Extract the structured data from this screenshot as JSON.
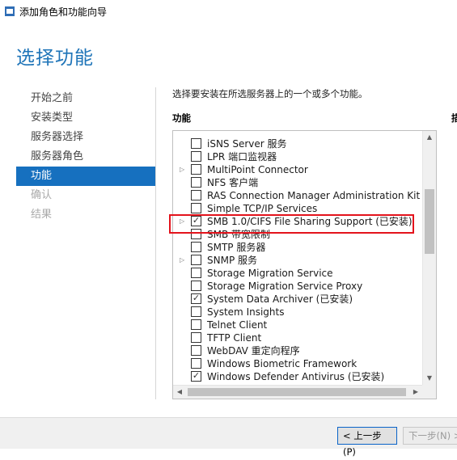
{
  "window": {
    "title": "添加角色和功能向导"
  },
  "page_heading": "选择功能",
  "nav": {
    "items": [
      {
        "label": "开始之前",
        "state": "normal"
      },
      {
        "label": "安装类型",
        "state": "normal"
      },
      {
        "label": "服务器选择",
        "state": "normal"
      },
      {
        "label": "服务器角色",
        "state": "normal"
      },
      {
        "label": "功能",
        "state": "active"
      },
      {
        "label": "确认",
        "state": "disabled"
      },
      {
        "label": "结果",
        "state": "disabled"
      }
    ]
  },
  "instruction": "选择要安装在所选服务器上的一个或多个功能。",
  "features_label": "功能",
  "description_label_partial": "描",
  "features": [
    {
      "label": "iSNS Server 服务",
      "checked": false,
      "expandable": false
    },
    {
      "label": "LPR 端口监视器",
      "checked": false,
      "expandable": false
    },
    {
      "label": "MultiPoint Connector",
      "checked": false,
      "expandable": true
    },
    {
      "label": "NFS 客户端",
      "checked": false,
      "expandable": false
    },
    {
      "label": "RAS Connection Manager Administration Kit (C",
      "checked": false,
      "expandable": false
    },
    {
      "label": "Simple TCP/IP Services",
      "checked": false,
      "expandable": false
    },
    {
      "label": "SMB 1.0/CIFS File Sharing Support (已安装)",
      "checked": true,
      "expandable": true,
      "highlighted": true
    },
    {
      "label": "SMB 带宽限制",
      "checked": false,
      "expandable": false
    },
    {
      "label": "SMTP 服务器",
      "checked": false,
      "expandable": false
    },
    {
      "label": "SNMP 服务",
      "checked": false,
      "expandable": true
    },
    {
      "label": "Storage Migration Service",
      "checked": false,
      "expandable": false
    },
    {
      "label": "Storage Migration Service Proxy",
      "checked": false,
      "expandable": false
    },
    {
      "label": "System Data Archiver (已安装)",
      "checked": true,
      "expandable": false
    },
    {
      "label": "System Insights",
      "checked": false,
      "expandable": false
    },
    {
      "label": "Telnet Client",
      "checked": false,
      "expandable": false
    },
    {
      "label": "TFTP Client",
      "checked": false,
      "expandable": false
    },
    {
      "label": "WebDAV 重定向程序",
      "checked": false,
      "expandable": false
    },
    {
      "label": "Windows Biometric Framework",
      "checked": false,
      "expandable": false
    },
    {
      "label": "Windows Defender Antivirus (已安装)",
      "checked": true,
      "expandable": false
    }
  ],
  "buttons": {
    "previous": "< 上一步(P)",
    "next": "下一步(N) >"
  },
  "colors": {
    "heading": "#1e74b8",
    "nav_active_bg": "#1670bf",
    "highlight_border": "#e3131c"
  },
  "icons": {
    "expander": "triangle-right",
    "checkmark": "✓",
    "scroll_up": "▲",
    "scroll_down": "▼",
    "scroll_left": "◀",
    "scroll_right": "▶"
  }
}
